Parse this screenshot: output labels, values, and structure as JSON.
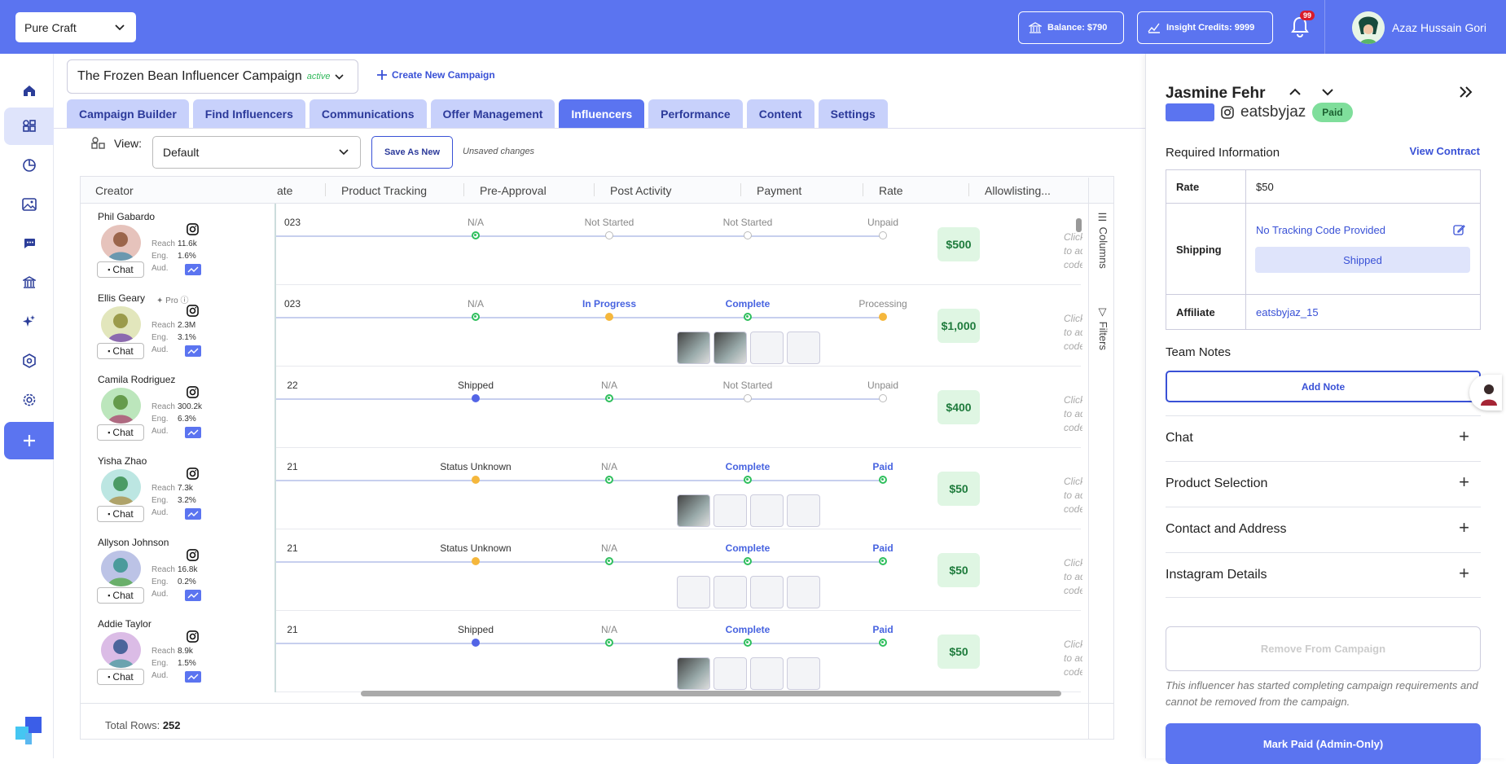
{
  "header": {
    "brand": "Pure Craft",
    "balance": "Balance: $790",
    "credits": "Insight Credits: 9999",
    "notifications": "99",
    "user_name": "Azaz Hussain Gori"
  },
  "campaign": {
    "name": "The Frozen Bean Influencer Campaign",
    "status": "active",
    "create_label": "Create New Campaign"
  },
  "tabs": [
    "Campaign Builder",
    "Find Influencers",
    "Communications",
    "Offer Management",
    "Influencers",
    "Performance",
    "Content",
    "Settings"
  ],
  "active_tab": "Influencers",
  "view": {
    "label": "View:",
    "value": "Default",
    "save_label": "Save As New",
    "unsaved": "Unsaved changes"
  },
  "columns": [
    "Creator",
    "ate",
    "Product Tracking",
    "Pre-Approval",
    "Post Activity",
    "Payment",
    "Rate",
    "Allowlisting..."
  ],
  "metric_labels": {
    "reach": "Reach",
    "eng": "Eng.",
    "aud": "Aud.",
    "chat": "Chat",
    "pro": "Pro"
  },
  "allow_text": [
    "Click to add",
    "code..."
  ],
  "rows": [
    {
      "name": "Phil Gabardo",
      "reach": "11.6k",
      "eng": "1.6%",
      "date": "023",
      "tracking": "N/A",
      "pre": "Not Started",
      "post": "Not Started",
      "payment": "Unpaid",
      "rate": "$500"
    },
    {
      "name": "Ellis Geary",
      "reach": "2.3M",
      "eng": "3.1%",
      "date": "023",
      "tracking": "N/A",
      "pre": "In Progress",
      "post": "Complete",
      "payment": "Processing",
      "rate": "$1,000"
    },
    {
      "name": "Camila Rodriguez",
      "reach": "300.2k",
      "eng": "6.3%",
      "date": "22",
      "tracking": "Shipped",
      "pre": "N/A",
      "post": "Not Started",
      "payment": "Unpaid",
      "rate": "$400"
    },
    {
      "name": "Yisha Zhao",
      "reach": "7.3k",
      "eng": "3.2%",
      "date": "21",
      "tracking": "Status Unknown",
      "pre": "N/A",
      "post": "Complete",
      "payment": "Paid",
      "rate": "$50"
    },
    {
      "name": "Allyson Johnson",
      "reach": "16.8k",
      "eng": "0.2%",
      "date": "21",
      "tracking": "Status Unknown",
      "pre": "N/A",
      "post": "Complete",
      "payment": "Paid",
      "rate": "$50"
    },
    {
      "name": "Addie Taylor",
      "reach": "8.9k",
      "eng": "1.5%",
      "date": "21",
      "tracking": "Shipped",
      "pre": "N/A",
      "post": "Complete",
      "payment": "Paid",
      "rate": "$50"
    }
  ],
  "footer": {
    "label": "Total Rows:",
    "value": "252"
  },
  "side_tabs": [
    "Columns",
    "Filters"
  ],
  "panel": {
    "name": "Jasmine Fehr",
    "handle": "eatsbyjaz",
    "status": "Paid",
    "required_title": "Required Information",
    "view_contract": "View Contract",
    "rate_label": "Rate",
    "rate_value": "$50",
    "shipping_label": "Shipping",
    "tracking": "No Tracking Code Provided",
    "shipped": "Shipped",
    "affiliate_label": "Affiliate",
    "affiliate_value": "eatsbyjaz_15",
    "team_notes": "Team Notes",
    "add_note": "Add Note",
    "sections": [
      "Chat",
      "Product Selection",
      "Contact and Address",
      "Instagram Details"
    ],
    "remove": "Remove From Campaign",
    "note": "This influencer has started completing campaign requirements and cannot be removed from the campaign.",
    "mark_paid": "Mark Paid (Admin-Only)"
  },
  "colors": {
    "accent": "#5b74f0",
    "green": "#2fbf5d",
    "yellow": "#f5b73c",
    "badge": "#d91c2b"
  }
}
